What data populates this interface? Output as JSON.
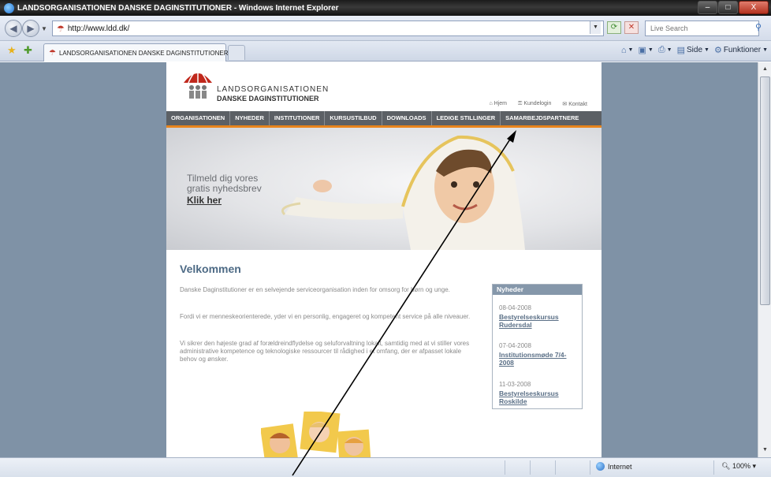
{
  "window": {
    "title": "LANDSORGANISATIONEN DANSKE DAGINSTITUTIONER - Windows Internet Explorer",
    "minimize": "–",
    "maximize": "□",
    "close": "X"
  },
  "addressbar": {
    "url": "http://www.ldd.dk/",
    "search_placeholder": "Live Search"
  },
  "tab": {
    "label": "LANDSORGANISATIONEN DANSKE DAGINSTITUTIONER"
  },
  "command_bar": {
    "page": "Side",
    "tools": "Funktioner"
  },
  "site": {
    "logo_line1": "LANDSORGANISATIONEN",
    "logo_line2": "DANSKE DAGINSTITUTIONER",
    "toplinks": {
      "home": "Hjem",
      "customer_login": "Kundelogin",
      "contact": "Kontakt"
    },
    "nav": [
      "ORGANISATIONEN",
      "NYHEDER",
      "INSTITUTIONER",
      "KURSUSTILBUD",
      "DOWNLOADS",
      "LEDIGE STILLINGER",
      "SAMARBEJDSPARTNERE"
    ],
    "hero": {
      "line1": "Tilmeld dig vores",
      "line2": "gratis nyhedsbrev",
      "link": "Klik her"
    },
    "welcome_title": "Velkommen",
    "paragraphs": [
      "Danske Daginstitutioner er en selvejende serviceorganisation inden for omsorg for børn og unge.",
      "Fordi vi er menneskeorienterede, yder vi en personlig, engageret og kompetent service på alle niveauer.",
      "Vi sikrer den højeste grad af forældreindflydelse og seluforvaltning lokalt, samtidig med at vi stiller vores administrative kompetence og teknologiske ressourcer til rådighed i et omfang, der er afpasset lokale behov og ønsker."
    ],
    "news": {
      "title": "Nyheder",
      "items": [
        {
          "date": "08-04-2008",
          "title": "Bestyrelseskursus Rudersdal"
        },
        {
          "date": "07-04-2008",
          "title": "Institutionsmøde 7/4-2008"
        },
        {
          "date": "11-03-2008",
          "title": "Bestyrelseskursus Roskilde"
        }
      ]
    }
  },
  "status": {
    "zone": "Internet",
    "zoom": "100%"
  }
}
